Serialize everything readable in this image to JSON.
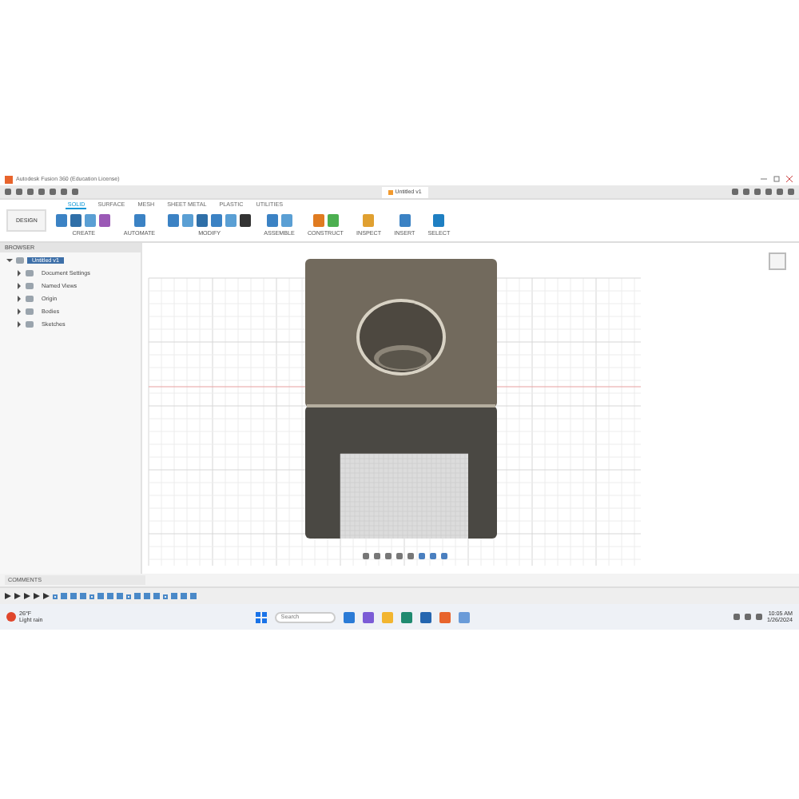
{
  "window": {
    "title": "Autodesk Fusion 360 (Education License)"
  },
  "document_tab": {
    "title": "Untitled v1"
  },
  "workspace": {
    "label": "DESIGN"
  },
  "ribbon_tabs": [
    {
      "label": "SOLID",
      "selected": true
    },
    {
      "label": "SURFACE",
      "selected": false
    },
    {
      "label": "MESH",
      "selected": false
    },
    {
      "label": "SHEET METAL",
      "selected": false
    },
    {
      "label": "PLASTIC",
      "selected": false
    },
    {
      "label": "UTILITIES",
      "selected": false
    }
  ],
  "ribbon_groups": [
    {
      "label": "CREATE"
    },
    {
      "label": "AUTOMATE"
    },
    {
      "label": "MODIFY"
    },
    {
      "label": "ASSEMBLE"
    },
    {
      "label": "CONSTRUCT"
    },
    {
      "label": "INSPECT"
    },
    {
      "label": "INSERT"
    },
    {
      "label": "SELECT"
    }
  ],
  "browser": {
    "title": "BROWSER",
    "root": {
      "label": "Untitled v1",
      "expanded": true,
      "selected": true,
      "children": [
        {
          "label": "Document Settings",
          "expanded": false,
          "selected": false
        },
        {
          "label": "Named Views",
          "expanded": false,
          "selected": false
        },
        {
          "label": "Origin",
          "expanded": false,
          "selected": false
        },
        {
          "label": "Bodies",
          "expanded": false,
          "selected": false
        },
        {
          "label": "Sketches",
          "expanded": false,
          "selected": false
        }
      ]
    }
  },
  "comments": {
    "title": "COMMENTS"
  },
  "taskbar": {
    "weather": {
      "temp": "26°F",
      "condition": "Light rain"
    },
    "search": {
      "placeholder": "Search"
    },
    "time": "10:05 AM",
    "date": "1/26/2024"
  }
}
